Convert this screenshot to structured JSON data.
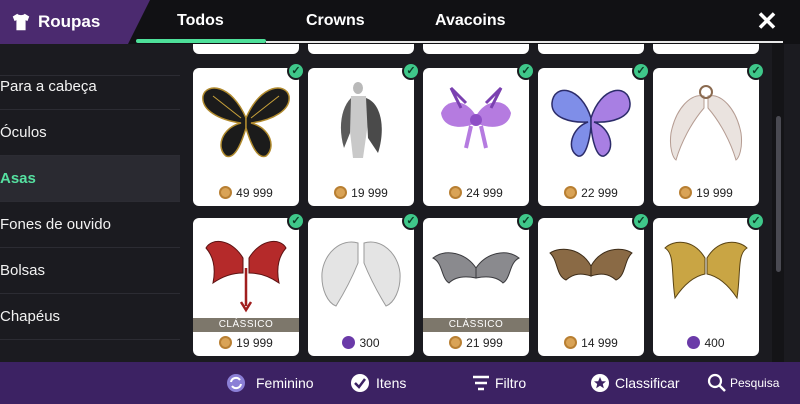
{
  "header": {
    "title": "Roupas",
    "tabs": [
      "Todos",
      "Crowns",
      "Avacoins"
    ]
  },
  "sidebar": {
    "items": [
      "Para a cabeça",
      "Óculos",
      "Asas",
      "Fones de ouvido",
      "Bolsas",
      "Chapéus"
    ],
    "active_index": 2
  },
  "grid": {
    "row1": [
      {
        "price": "49 999",
        "currency": "coin",
        "owned": true
      },
      {
        "price": "19 999",
        "currency": "coin",
        "owned": true
      },
      {
        "price": "24 999",
        "currency": "coin",
        "owned": true
      },
      {
        "price": "22 999",
        "currency": "coin",
        "owned": true
      },
      {
        "price": "19 999",
        "currency": "coin",
        "owned": true
      }
    ],
    "row2": [
      {
        "price": "19 999",
        "currency": "coin",
        "owned": true,
        "badge": "CLÁSSICO"
      },
      {
        "price": "300",
        "currency": "gem",
        "owned": true
      },
      {
        "price": "21 999",
        "currency": "coin",
        "owned": true,
        "badge": "CLÁSSICO"
      },
      {
        "price": "14 999",
        "currency": "coin",
        "owned": true
      },
      {
        "price": "400",
        "currency": "gem",
        "owned": true
      }
    ]
  },
  "bottom": {
    "feminino": "Feminino",
    "itens": "Itens",
    "filtro": "Filtro",
    "classificar": "Classificar",
    "pesquisa": "Pesquisa"
  },
  "colors": {
    "accent_green": "#4ee09a",
    "purple": "#4b2a6f",
    "bottom_purple": "#3c2263"
  }
}
